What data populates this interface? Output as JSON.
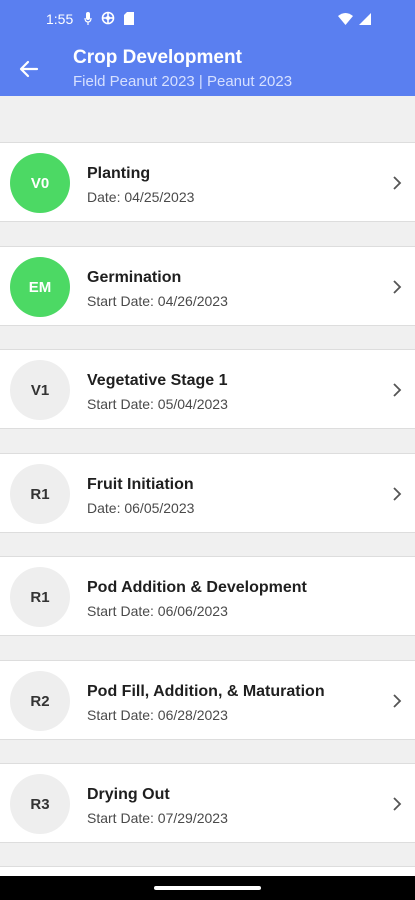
{
  "status_bar": {
    "time": "1:55",
    "icons_left": [
      "mic-icon",
      "at-icon",
      "sim-card-icon"
    ],
    "icons_right": [
      "wifi-icon",
      "signal-icon"
    ]
  },
  "header": {
    "title": "Crop Development",
    "subtitle": "Field Peanut 2023 | Peanut 2023",
    "back_icon": "arrow-back-icon",
    "background_color": "#5a7ff0"
  },
  "stages": [
    {
      "code": "V0",
      "name": "Planting",
      "date": "Date: 04/25/2023",
      "active": true,
      "chevron": true
    },
    {
      "code": "EM",
      "name": "Germination",
      "date": "Start Date: 04/26/2023",
      "active": true,
      "chevron": true
    },
    {
      "code": "V1",
      "name": "Vegetative Stage 1",
      "date": "Start Date: 05/04/2023",
      "active": false,
      "chevron": true
    },
    {
      "code": "R1",
      "name": "Fruit Initiation",
      "date": "Date: 06/05/2023",
      "active": false,
      "chevron": true
    },
    {
      "code": "R1",
      "name": "Pod Addition & Development",
      "date": "Start Date: 06/06/2023",
      "active": false,
      "chevron": false
    },
    {
      "code": "R2",
      "name": "Pod Fill, Addition, & Maturation",
      "date": "Start Date: 06/28/2023",
      "active": false,
      "chevron": true
    },
    {
      "code": "R3",
      "name": "Drying Out",
      "date": "Start Date: 07/29/2023",
      "active": false,
      "chevron": true
    }
  ],
  "colors": {
    "active_badge": "#4cd964",
    "inactive_badge": "#eeeeee"
  }
}
